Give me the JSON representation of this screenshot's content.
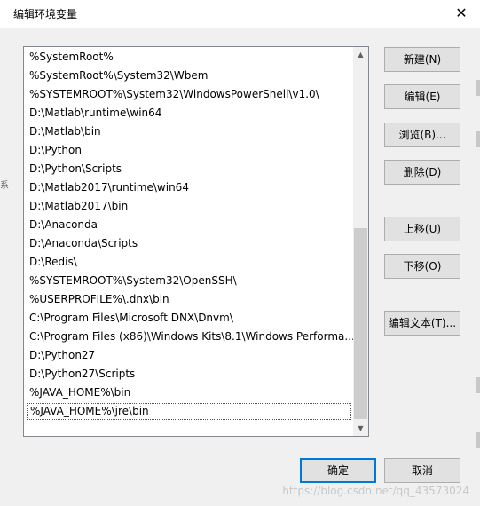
{
  "window": {
    "title": "编辑环境变量",
    "close_glyph": "✕"
  },
  "path_list": {
    "items": [
      "%SystemRoot%",
      "%SystemRoot%\\System32\\Wbem",
      "%SYSTEMROOT%\\System32\\WindowsPowerShell\\v1.0\\",
      "D:\\Matlab\\runtime\\win64",
      "D:\\Matlab\\bin",
      "D:\\Python",
      "D:\\Python\\Scripts",
      "D:\\Matlab2017\\runtime\\win64",
      "D:\\Matlab2017\\bin",
      "D:\\Anaconda",
      "D:\\Anaconda\\Scripts",
      "D:\\Redis\\",
      "%SYSTEMROOT%\\System32\\OpenSSH\\",
      "%USERPROFILE%\\.dnx\\bin",
      "C:\\Program Files\\Microsoft DNX\\Dnvm\\",
      "C:\\Program Files (x86)\\Windows Kits\\8.1\\Windows Performa...",
      "D:\\Python27",
      "D:\\Python27\\Scripts",
      "%JAVA_HOME%\\bin",
      "%JAVA_HOME%\\jre\\bin"
    ],
    "selected_index": 19
  },
  "buttons": {
    "new": "新建(N)",
    "edit": "编辑(E)",
    "browse": "浏览(B)...",
    "delete": "删除(D)",
    "move_up": "上移(U)",
    "move_down": "下移(O)",
    "edit_text": "编辑文本(T)...",
    "ok": "确定",
    "cancel": "取消"
  },
  "watermark": "https://blog.csdn.net/qq_43573024",
  "background_edge": {
    "left_char": "系"
  },
  "colors": {
    "accent": "#0078d7",
    "dialog_bg": "#f0f0f0"
  }
}
